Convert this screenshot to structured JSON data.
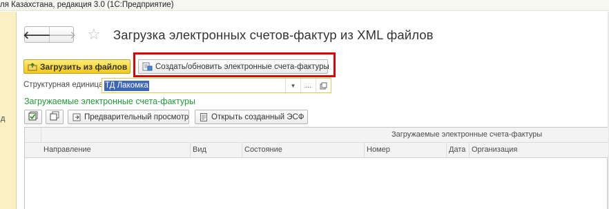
{
  "window": {
    "title": "ля Казахстана, редакция 3.0  (1С:Предприятие)",
    "left_fragment": "д"
  },
  "nav": {
    "back_glyph": "🡐",
    "forward_glyph": "🡒",
    "favorite_glyph": "☆"
  },
  "page": {
    "title": "Загрузка электронных счетов-фактур из XML файлов"
  },
  "toolbar": {
    "load_label": "Загрузить из файлов",
    "create_label": "Создать/обновить электронные счета-фактуры"
  },
  "structural_unit": {
    "label": "Структурная единица:",
    "value": "ТД Лакомка",
    "dropdown_glyph": "▼",
    "choose_glyph": "..."
  },
  "section": {
    "title": "Загружаемые электронные счета-фактуры"
  },
  "table_toolbar": {
    "preview_label": "Предварительный просмотр",
    "open_label": "Открыть созданный ЭСФ"
  },
  "table": {
    "group_header": "Загружаемые электронные счета-фактуры",
    "columns": [
      "Направление",
      "Вид",
      "Состояние",
      "Номер",
      "Дата",
      "Организация"
    ],
    "rows": []
  },
  "colors": {
    "highlight_border": "#e00000",
    "load_button": "#f2c813",
    "section_title": "#1f9a36",
    "selection": "#3d67b6"
  }
}
